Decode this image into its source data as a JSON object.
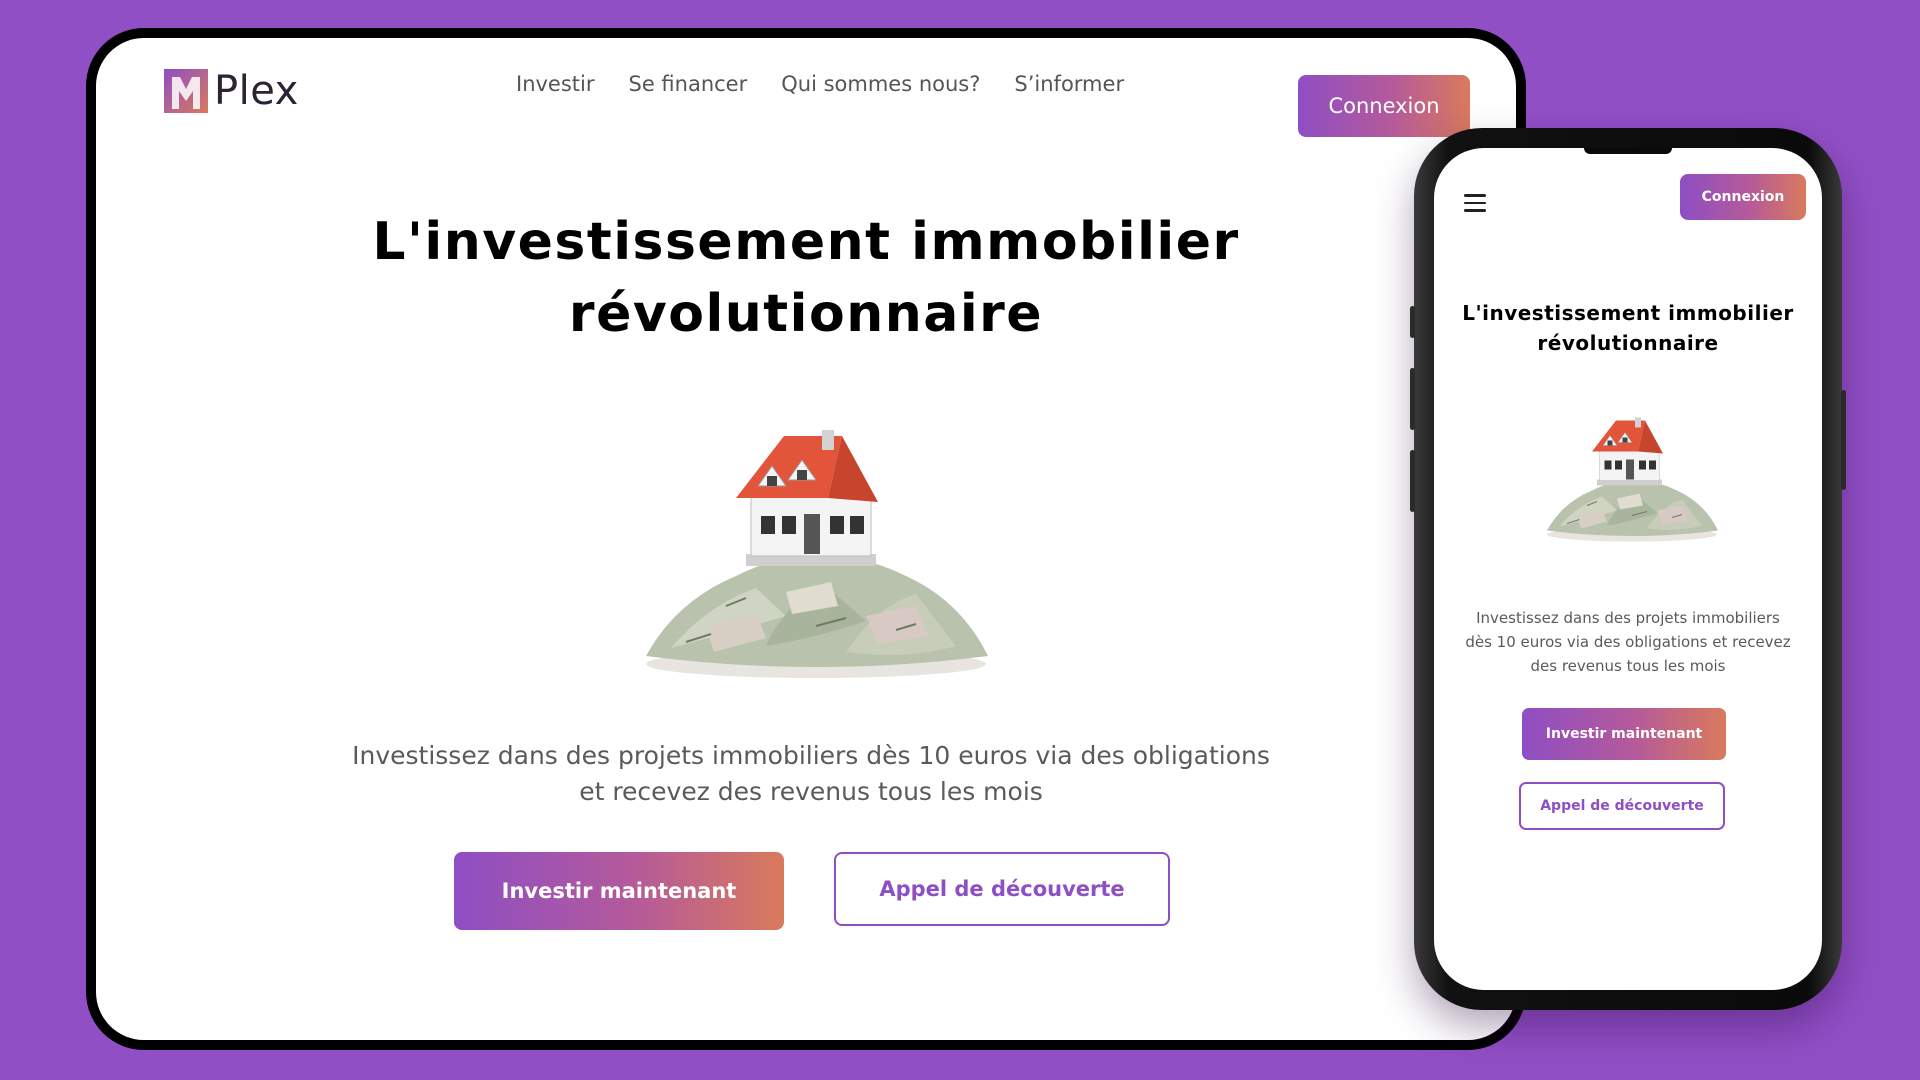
{
  "colors": {
    "background": "#914fc6",
    "accent_purple": "#8e4ec4",
    "accent_orange": "#d97a5c",
    "text_dark": "#000000",
    "text_muted": "#5a5a5a"
  },
  "desktop": {
    "logo": {
      "icon": "plex-logo-icon",
      "text": "Plex"
    },
    "nav": {
      "items": [
        {
          "label": "Investir"
        },
        {
          "label": "Se financer"
        },
        {
          "label": "Qui sommes nous?"
        },
        {
          "label": "S’informer"
        }
      ],
      "login_label": "Connexion"
    },
    "hero": {
      "title_line1": "L'investissement immobilier",
      "title_line2": "révolutionnaire",
      "illustration": "house-on-money-pile-image",
      "subtitle_line1": "Investissez dans des projets immobiliers dès 10 euros via des obligations",
      "subtitle_line2": "et recevez des revenus tous les mois",
      "primary_cta": "Investir maintenant",
      "secondary_cta": "Appel de découverte"
    }
  },
  "mobile": {
    "menu_icon": "hamburger-menu-icon",
    "login_label": "Connexion",
    "hero": {
      "title_line1": "L'investissement immobilier",
      "title_line2": "révolutionnaire",
      "illustration": "house-on-money-pile-image",
      "subtitle_line1": "Investissez dans des projets immobiliers",
      "subtitle_line2": "dès 10 euros via des obligations et recevez",
      "subtitle_line3": "des revenus tous les mois",
      "primary_cta": "Investir maintenant",
      "secondary_cta": "Appel de découverte"
    }
  }
}
